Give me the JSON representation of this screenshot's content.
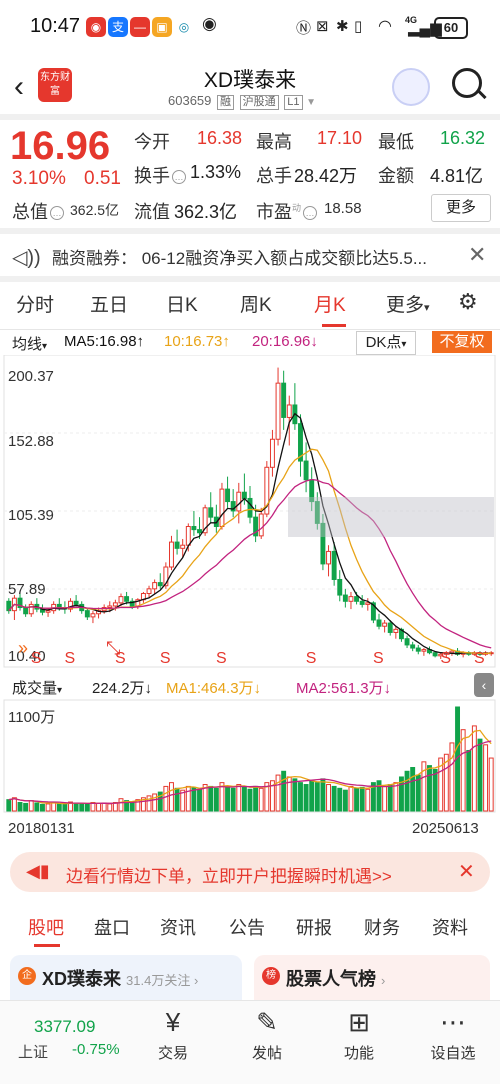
{
  "status_bar": {
    "time": "10:47",
    "network": "4G",
    "battery": "60"
  },
  "header": {
    "logo_text": "东方财富",
    "title": "XD璞泰来",
    "code": "603659",
    "tags": [
      "融",
      "沪股通",
      "L1"
    ]
  },
  "quote": {
    "price": "16.96",
    "change_pct": "3.10%",
    "change": "0.51",
    "open_label": "今开",
    "open": "16.38",
    "high_label": "最高",
    "high": "17.10",
    "low_label": "最低",
    "low": "16.32",
    "turnover_label": "换手",
    "turnover": "1.33%",
    "volume_label": "总手",
    "volume": "28.42万",
    "amount_label": "金额",
    "amount": "4.81亿",
    "total_value_label": "总值",
    "total_value": "362.5亿",
    "float_value_label": "流值",
    "float_value": "362.3亿",
    "pe_label": "市盈",
    "pe_sup": "动",
    "pe": "18.58",
    "more_label": "更多"
  },
  "news": {
    "text": "融资融券：  06-12融资净买入额占成交额比达5.5..."
  },
  "period_tabs": [
    "分时",
    "五日",
    "日K",
    "周K",
    "月K",
    "更多"
  ],
  "active_period": "月K",
  "indicators": {
    "type": "均线",
    "ma5": "MA5:16.98↑",
    "ma10": "10:16.73↑",
    "ma20": "20:16.96↓",
    "dk": "DK点",
    "fq": "不复权"
  },
  "price_axis": [
    "200.37",
    "152.88",
    "105.39",
    "57.89",
    "10.40"
  ],
  "volume_header": {
    "type": "成交量",
    "vol": "224.2万↓",
    "ma1": "MA1:464.3万↓",
    "ma2": "MA2:561.3万↓",
    "max_label": "1100万"
  },
  "dates": {
    "start": "20180131",
    "end": "20250613"
  },
  "banner": {
    "text": "边看行情边下单，立即开户把握瞬时机遇>>"
  },
  "bottom_tabs": [
    "股吧",
    "盘口",
    "资讯",
    "公告",
    "研报",
    "财务",
    "资料"
  ],
  "active_bottom_tab": "股吧",
  "cards": [
    {
      "icon": "企",
      "title": "XD璞泰来",
      "sub": "31.4万关注 ›"
    },
    {
      "icon": "榜",
      "title": "股票人气榜",
      "sub": "›"
    }
  ],
  "bottom_nav": {
    "index_value": "3377.09",
    "index_label": "上证",
    "index_pct": "-0.75%",
    "items": [
      "交易",
      "发帖",
      "功能",
      "设自选"
    ]
  },
  "colors": {
    "up": "#e5372d",
    "down": "#11a34a",
    "ma5": "#111111",
    "ma10": "#e8a317",
    "ma20": "#c2237f"
  },
  "chart_data": {
    "type": "candlestick",
    "period": "monthly",
    "ylim": [
      10.4,
      200.37
    ],
    "y_ticks": [
      200.37,
      152.88,
      105.39,
      57.89,
      10.4
    ],
    "x_range": [
      "20180131",
      "20250613"
    ],
    "candles": [
      [
        50,
        52,
        42,
        44
      ],
      [
        44,
        54,
        38,
        52
      ],
      [
        52,
        56,
        44,
        46
      ],
      [
        46,
        48,
        40,
        42
      ],
      [
        42,
        50,
        40,
        48
      ],
      [
        48,
        52,
        43,
        45
      ],
      [
        45,
        48,
        41,
        43
      ],
      [
        43,
        46,
        40,
        44
      ],
      [
        44,
        50,
        42,
        48
      ],
      [
        48,
        52,
        44,
        46
      ],
      [
        46,
        50,
        42,
        45
      ],
      [
        45,
        52,
        43,
        50
      ],
      [
        50,
        54,
        46,
        48
      ],
      [
        48,
        50,
        42,
        44
      ],
      [
        44,
        46,
        38,
        40
      ],
      [
        40,
        44,
        36,
        42
      ],
      [
        42,
        46,
        39,
        44
      ],
      [
        44,
        48,
        42,
        46
      ],
      [
        46,
        50,
        43,
        47
      ],
      [
        47,
        51,
        44,
        49
      ],
      [
        49,
        55,
        47,
        53
      ],
      [
        53,
        56,
        48,
        50
      ],
      [
        50,
        52,
        45,
        47
      ],
      [
        47,
        52,
        45,
        51
      ],
      [
        51,
        56,
        49,
        55
      ],
      [
        55,
        60,
        52,
        58
      ],
      [
        58,
        64,
        55,
        62
      ],
      [
        62,
        68,
        58,
        60
      ],
      [
        60,
        75,
        58,
        72
      ],
      [
        72,
        92,
        70,
        88
      ],
      [
        88,
        96,
        80,
        84
      ],
      [
        84,
        90,
        78,
        86
      ],
      [
        86,
        100,
        82,
        98
      ],
      [
        98,
        108,
        92,
        96
      ],
      [
        96,
        104,
        90,
        94
      ],
      [
        94,
        112,
        92,
        110
      ],
      [
        110,
        120,
        100,
        104
      ],
      [
        104,
        112,
        94,
        98
      ],
      [
        98,
        126,
        96,
        122
      ],
      [
        122,
        130,
        110,
        114
      ],
      [
        114,
        122,
        104,
        108
      ],
      [
        108,
        126,
        100,
        120
      ],
      [
        120,
        132,
        112,
        116
      ],
      [
        116,
        124,
        100,
        104
      ],
      [
        104,
        112,
        88,
        92
      ],
      [
        92,
        110,
        90,
        106
      ],
      [
        106,
        140,
        104,
        136
      ],
      [
        136,
        160,
        130,
        154
      ],
      [
        154,
        200,
        150,
        190
      ],
      [
        190,
        198,
        160,
        168
      ],
      [
        168,
        182,
        150,
        176
      ],
      [
        176,
        190,
        160,
        164
      ],
      [
        164,
        170,
        130,
        140
      ],
      [
        140,
        152,
        120,
        128
      ],
      [
        128,
        136,
        108,
        114
      ],
      [
        114,
        120,
        96,
        100
      ],
      [
        100,
        106,
        70,
        74
      ],
      [
        74,
        86,
        66,
        82
      ],
      [
        82,
        88,
        60,
        64
      ],
      [
        64,
        70,
        50,
        54
      ],
      [
        54,
        58,
        46,
        50
      ],
      [
        50,
        56,
        45,
        53
      ],
      [
        53,
        56,
        48,
        50
      ],
      [
        50,
        54,
        46,
        48
      ],
      [
        48,
        52,
        44,
        49
      ],
      [
        49,
        50,
        36,
        38
      ],
      [
        38,
        42,
        32,
        34
      ],
      [
        34,
        38,
        30,
        36
      ],
      [
        36,
        38,
        28,
        30
      ],
      [
        30,
        34,
        26,
        32
      ],
      [
        32,
        33,
        24,
        26
      ],
      [
        26,
        28,
        20,
        22
      ],
      [
        22,
        24,
        18,
        20
      ],
      [
        20,
        22,
        16,
        18
      ],
      [
        18,
        20,
        15,
        19
      ],
      [
        19,
        21,
        16,
        17
      ],
      [
        17,
        18,
        14,
        15
      ],
      [
        15,
        17,
        13,
        16
      ],
      [
        16,
        18,
        14,
        17
      ],
      [
        17,
        19,
        15,
        18
      ],
      [
        18,
        20,
        15,
        16
      ],
      [
        16,
        18,
        14,
        17
      ],
      [
        17,
        18,
        15,
        16
      ],
      [
        16,
        18,
        15,
        17
      ],
      [
        17,
        18,
        15,
        16
      ],
      [
        16,
        18,
        15,
        17
      ],
      [
        17,
        18,
        15,
        17
      ]
    ],
    "volumes": [
      120,
      140,
      90,
      80,
      110,
      85,
      70,
      75,
      90,
      80,
      70,
      95,
      85,
      80,
      70,
      90,
      80,
      85,
      75,
      90,
      130,
      110,
      100,
      120,
      140,
      160,
      180,
      200,
      260,
      300,
      240,
      220,
      260,
      250,
      230,
      280,
      260,
      240,
      300,
      260,
      240,
      280,
      250,
      230,
      260,
      240,
      300,
      320,
      380,
      420,
      360,
      340,
      300,
      280,
      320,
      300,
      340,
      280,
      260,
      240,
      220,
      260,
      240,
      250,
      230,
      300,
      320,
      260,
      280,
      300,
      360,
      420,
      460,
      380,
      520,
      480,
      440,
      560,
      600,
      720,
      1100,
      860,
      640,
      900,
      760,
      700,
      560
    ],
    "sell_markers": [
      "S",
      "S",
      "S",
      "S",
      "S",
      "S",
      "S",
      "S",
      "S"
    ]
  }
}
